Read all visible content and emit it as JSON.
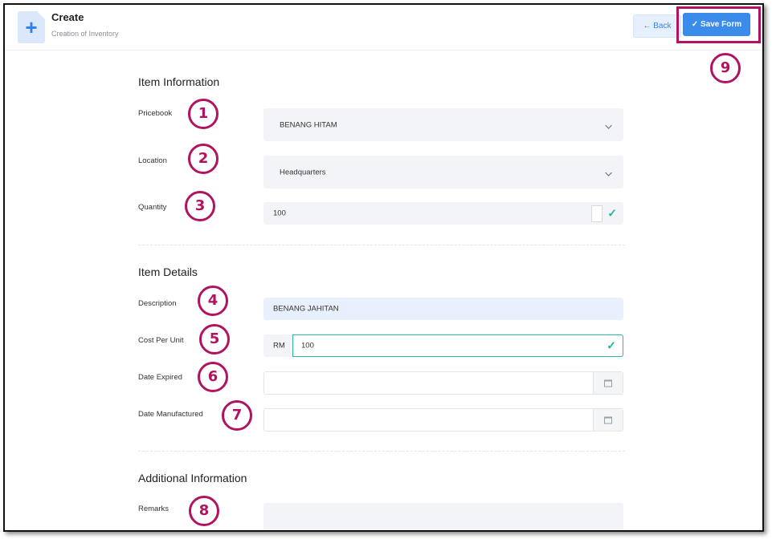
{
  "header": {
    "title": "Create",
    "subtitle": "Creation of Inventory",
    "back_label": "← Back",
    "save_label": "✓ Save Form"
  },
  "sections": {
    "item_information": "Item Information",
    "item_details": "Item Details",
    "additional_information": "Additional Information"
  },
  "fields": {
    "pricebook": {
      "label": "Pricebook",
      "value": "BENANG HITAM"
    },
    "location": {
      "label": "Location",
      "value": "Headquarters"
    },
    "quantity": {
      "label": "Quantity",
      "value": "100"
    },
    "description": {
      "label": "Description",
      "value": "BENANG JAHITAN"
    },
    "cost_per_unit": {
      "label": "Cost Per Unit",
      "prefix": "RM",
      "value": "100"
    },
    "date_expired": {
      "label": "Date Expired",
      "value": ""
    },
    "date_manufactured": {
      "label": "Date Manufactured",
      "value": ""
    },
    "remarks": {
      "label": "Remarks",
      "value": ""
    }
  },
  "annotations": [
    "1",
    "2",
    "3",
    "4",
    "5",
    "6",
    "7",
    "8",
    "9"
  ],
  "colors": {
    "accent": "#3b8bea",
    "annotation": "#b1135f",
    "valid": "#22b5a0"
  }
}
